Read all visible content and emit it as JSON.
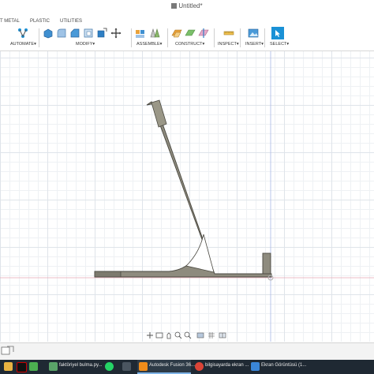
{
  "window": {
    "title": "Untitled*"
  },
  "tabs": [
    "T METAL",
    "PLASTIC",
    "UTILITIES"
  ],
  "toolbar": {
    "groups": [
      "AUTOMATE",
      "MODIFY",
      "ASSEMBLE",
      "CONSTRUCT",
      "INSPECT",
      "INSERT",
      "SELECT"
    ],
    "dropdown_glyph": "▾"
  },
  "taskbar": {
    "items": [
      {
        "label": "faktöriyel bulma.py..."
      },
      {
        "label": "Autodesk Fusion 36..."
      },
      {
        "label": "bilgisayarda ekran ..."
      },
      {
        "label": "Ekran Görüntüsü (1..."
      }
    ]
  },
  "colors": {
    "part_fill": "#8e8b7e",
    "part_stroke": "#4a4840",
    "accent": "#1a91d6",
    "x_axis": "#e9a9b4",
    "y_axis": "#a9b8e6",
    "origin_point": "#b0b0b0"
  }
}
